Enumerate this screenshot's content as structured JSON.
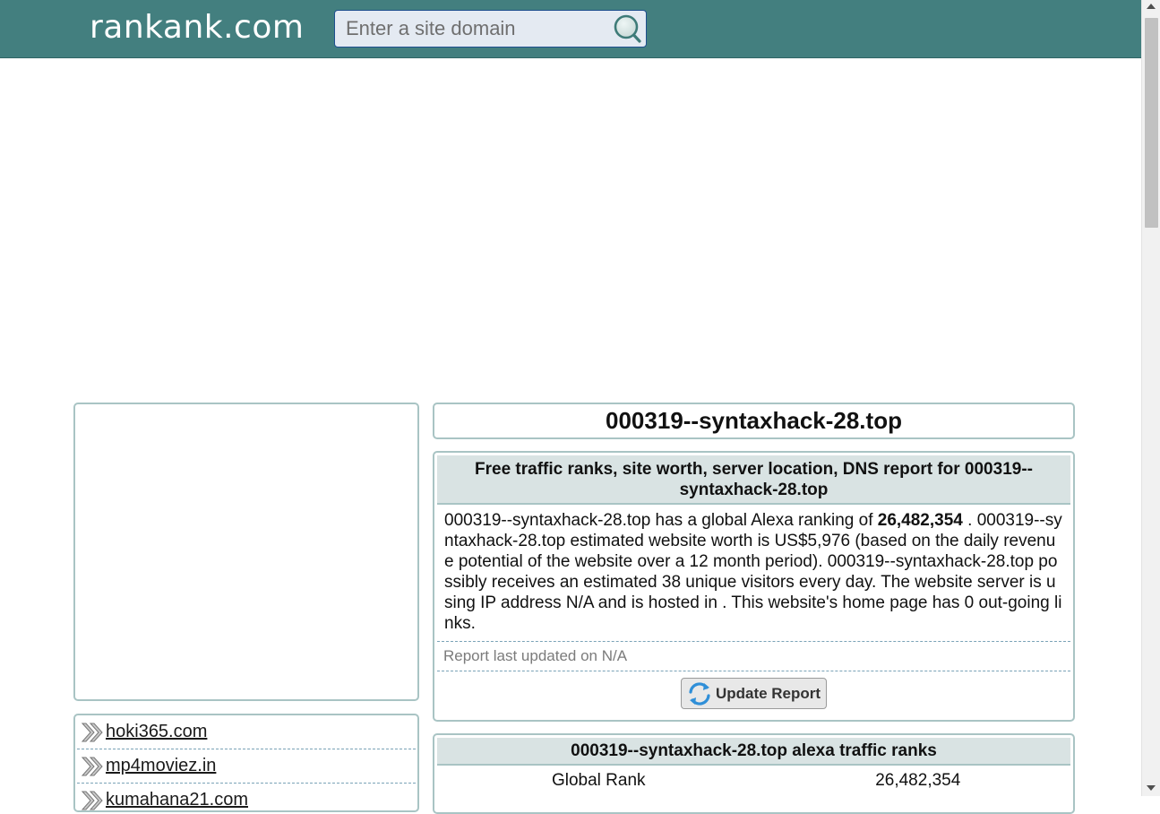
{
  "header": {
    "logo": "rankank.com",
    "search_placeholder": "Enter a site domain"
  },
  "sidebar": {
    "links": [
      {
        "label": "hoki365.com"
      },
      {
        "label": "mp4moviez.in"
      },
      {
        "label": "kumahana21.com"
      }
    ]
  },
  "main": {
    "site_title": "000319--syntaxhack-28.top",
    "report": {
      "heading": "Free traffic ranks, site worth, server location, DNS report for 000319--syntaxhack-28.top",
      "text_before_rank": "000319--syntaxhack-28.top has a global Alexa ranking of ",
      "rank": "26,482,354",
      "text_after_rank": " . 000319--syntaxhack-28.top estimated website worth is US$5,976 (based on the daily revenue potential of the website over a 12 month period). 000319--syntaxhack-28.top possibly receives an estimated 38 unique visitors every day. The website server is using IP address N/A and is hosted in . This website's home page has 0 out-going links.",
      "last_updated": "Report last updated on N/A",
      "update_button": "Update Report"
    },
    "traffic_ranks": {
      "heading": "000319--syntaxhack-28.top alexa traffic ranks",
      "rows": [
        {
          "label": "Global Rank",
          "value": "26,482,354"
        }
      ]
    }
  },
  "colors": {
    "header_bg": "#437f7f",
    "panel_border": "#a9c4c4",
    "panel_head_bg": "#d9e3e3",
    "dashed_divider": "#7aa3b7"
  }
}
